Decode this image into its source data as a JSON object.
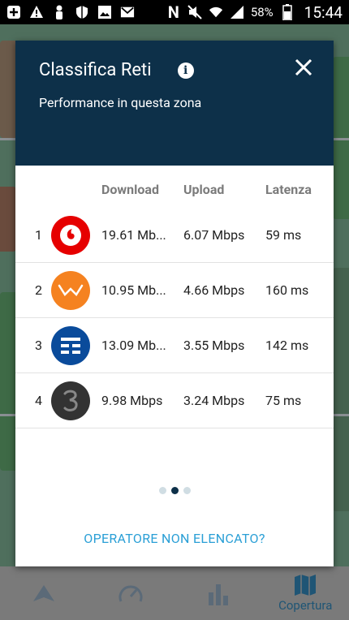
{
  "status_bar": {
    "battery": "58%",
    "time": "15:44"
  },
  "modal": {
    "title": "Classifica Reti",
    "subtitle": "Performance in questa zona",
    "columns": {
      "download": "Download",
      "upload": "Upload",
      "latency": "Latenza"
    },
    "rows": [
      {
        "rank": "1",
        "operator_icon": "vodafone-logo",
        "download": "19.61 Mb...",
        "upload": "6.07 Mbps",
        "latency": "59 ms"
      },
      {
        "rank": "2",
        "operator_icon": "wind-logo",
        "download": "10.95 Mb...",
        "upload": "4.66 Mbps",
        "latency": "160 ms"
      },
      {
        "rank": "3",
        "operator_icon": "tim-logo",
        "download": "13.09 Mb...",
        "upload": "3.55 Mbps",
        "latency": "142 ms"
      },
      {
        "rank": "4",
        "operator_icon": "tre-logo",
        "download": "9.98 Mbps",
        "upload": "3.24 Mbps",
        "latency": "75 ms"
      }
    ],
    "page_indicator": {
      "count": 3,
      "active_index": 1
    },
    "footer_link": "OPERATORE NON ELENCATO?"
  },
  "bottom_nav": {
    "items": [
      {
        "icon": "speedtest-arrow-icon",
        "label": ""
      },
      {
        "icon": "gauge-icon",
        "label": ""
      },
      {
        "icon": "bar-chart-icon",
        "label": ""
      },
      {
        "icon": "map-icon",
        "label": "Copertura"
      }
    ]
  },
  "colors": {
    "header_bg": "#0d3049",
    "link": "#2a9fd6",
    "vodafone": "#e60000",
    "wind": "#f58220",
    "tim": "#0a4b9b",
    "tre": "#333333"
  }
}
